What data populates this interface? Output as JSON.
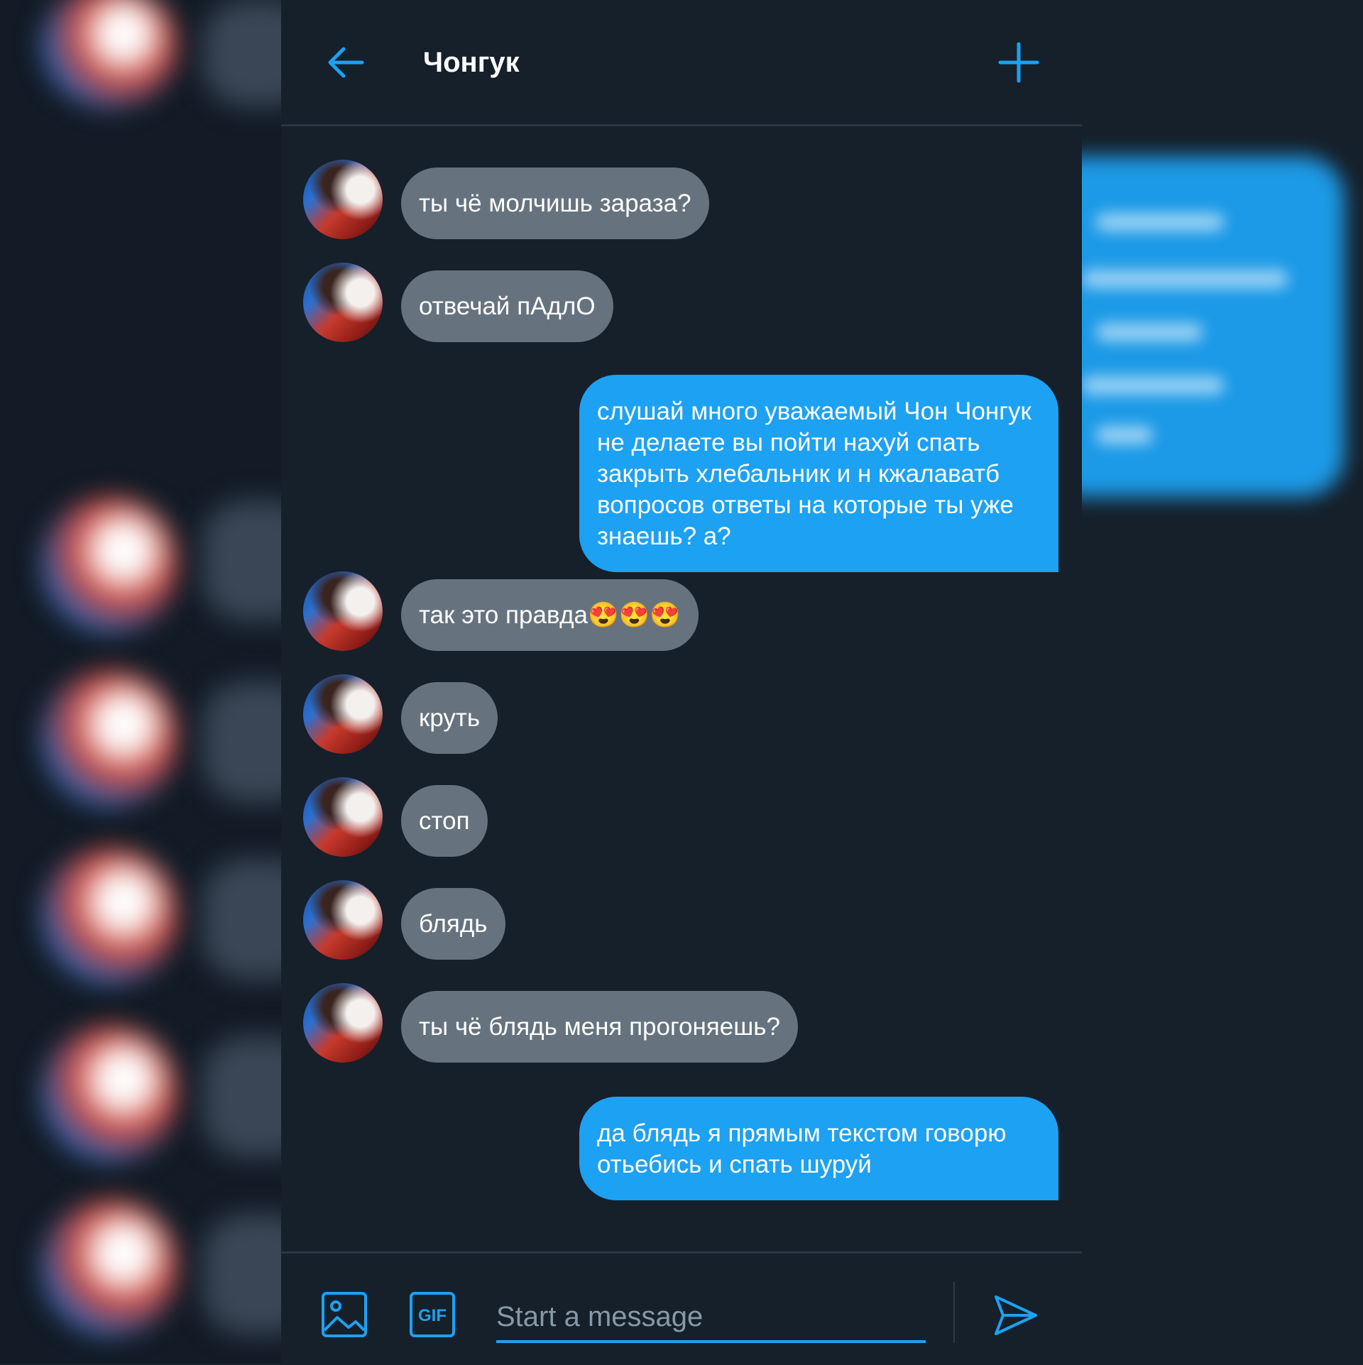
{
  "conversation": {
    "title": "Чонгук"
  },
  "colors": {
    "background": "#15202b",
    "accent": "#1da1f2",
    "incoming_bubble": "#66737f",
    "outgoing_bubble": "#1da1f2"
  },
  "icons": {
    "back": "arrow-left-icon",
    "add": "plus-icon",
    "image": "image-icon",
    "gif": "gif-icon",
    "send": "send-icon"
  },
  "messages": [
    {
      "direction": "in",
      "text": "ты чё молчишь зараза?"
    },
    {
      "direction": "in",
      "text": "отвечай пАдлО"
    },
    {
      "direction": "out",
      "text": "слушай много уважаемый Чон Чонгук не делаете вы пойти нахуй спать закрыть хлебальник и н кжалаватб вопросов ответы на которые ты уже знаешь? а?"
    },
    {
      "direction": "in",
      "text": "так это правда😍😍😍"
    },
    {
      "direction": "in",
      "text": "круть"
    },
    {
      "direction": "in",
      "text": "стоп"
    },
    {
      "direction": "in",
      "text": "блядь"
    },
    {
      "direction": "in",
      "text": "ты чё блядь меня прогоняешь?"
    },
    {
      "direction": "out",
      "text": "да блядь я прямым текстом говорю отьебись и спать шуруй"
    }
  ],
  "composer": {
    "placeholder": "Start a message",
    "value": "",
    "gif_label": "GIF"
  }
}
